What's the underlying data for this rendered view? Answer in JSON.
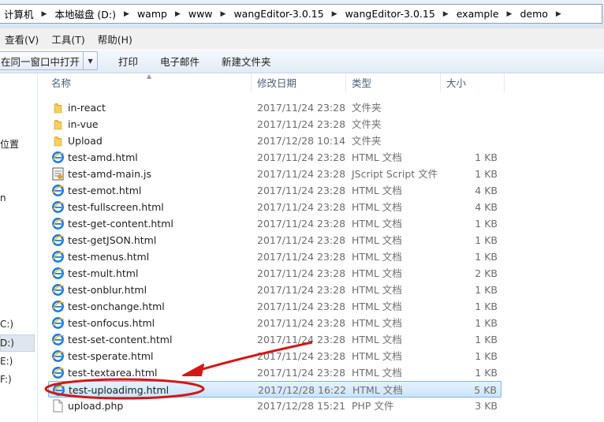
{
  "breadcrumb": [
    "计算机",
    "本地磁盘 (D:)",
    "wamp",
    "www",
    "wangEditor-3.0.15",
    "wangEditor-3.0.15",
    "example",
    "demo"
  ],
  "menu": [
    "查看(V)",
    "工具(T)",
    "帮助(H)"
  ],
  "toolbar": {
    "open_label": "在同一窗口中打开",
    "buttons": [
      "打印",
      "电子邮件",
      "新建文件夹"
    ]
  },
  "nav_items": [
    "位置",
    "n",
    "C:)",
    "D:)",
    "E:)",
    "F:)"
  ],
  "columns": {
    "name": "名称",
    "date": "修改日期",
    "type": "类型",
    "size": "大小"
  },
  "files": [
    {
      "name": "in-react",
      "date": "2017/11/24 23:28",
      "type": "文件夹",
      "size": "",
      "icon": "folder-icon"
    },
    {
      "name": "in-vue",
      "date": "2017/11/24 23:28",
      "type": "文件夹",
      "size": "",
      "icon": "folder-icon"
    },
    {
      "name": "Upload",
      "date": "2017/12/28 10:14",
      "type": "文件夹",
      "size": "",
      "icon": "folder-icon"
    },
    {
      "name": "test-amd.html",
      "date": "2017/11/24 23:28",
      "type": "HTML 文档",
      "size": "1 KB",
      "icon": "ie-html-icon"
    },
    {
      "name": "test-amd-main.js",
      "date": "2017/11/24 23:28",
      "type": "JScript Script 文件",
      "size": "1 KB",
      "icon": "jscript-icon"
    },
    {
      "name": "test-emot.html",
      "date": "2017/11/24 23:28",
      "type": "HTML 文档",
      "size": "4 KB",
      "icon": "ie-html-icon"
    },
    {
      "name": "test-fullscreen.html",
      "date": "2017/11/24 23:28",
      "type": "HTML 文档",
      "size": "4 KB",
      "icon": "ie-html-icon"
    },
    {
      "name": "test-get-content.html",
      "date": "2017/11/24 23:28",
      "type": "HTML 文档",
      "size": "1 KB",
      "icon": "ie-html-icon"
    },
    {
      "name": "test-getJSON.html",
      "date": "2017/11/24 23:28",
      "type": "HTML 文档",
      "size": "1 KB",
      "icon": "ie-html-icon"
    },
    {
      "name": "test-menus.html",
      "date": "2017/11/24 23:28",
      "type": "HTML 文档",
      "size": "1 KB",
      "icon": "ie-html-icon"
    },
    {
      "name": "test-mult.html",
      "date": "2017/11/24 23:28",
      "type": "HTML 文档",
      "size": "2 KB",
      "icon": "ie-html-icon"
    },
    {
      "name": "test-onblur.html",
      "date": "2017/11/24 23:28",
      "type": "HTML 文档",
      "size": "1 KB",
      "icon": "ie-html-icon"
    },
    {
      "name": "test-onchange.html",
      "date": "2017/11/24 23:28",
      "type": "HTML 文档",
      "size": "1 KB",
      "icon": "ie-html-icon"
    },
    {
      "name": "test-onfocus.html",
      "date": "2017/11/24 23:28",
      "type": "HTML 文档",
      "size": "1 KB",
      "icon": "ie-html-icon"
    },
    {
      "name": "test-set-content.html",
      "date": "2017/11/24 23:28",
      "type": "HTML 文档",
      "size": "1 KB",
      "icon": "ie-html-icon"
    },
    {
      "name": "test-sperate.html",
      "date": "2017/11/24 23:28",
      "type": "HTML 文档",
      "size": "1 KB",
      "icon": "ie-html-icon"
    },
    {
      "name": "test-textarea.html",
      "date": "2017/11/24 23:28",
      "type": "HTML 文档",
      "size": "1 KB",
      "icon": "ie-html-icon"
    },
    {
      "name": "test-uploadimg.html",
      "date": "2017/12/28 16:22",
      "type": "HTML 文档",
      "size": "5 KB",
      "icon": "ie-html-icon",
      "selected": true
    },
    {
      "name": "upload.php",
      "date": "2017/12/28 15:21",
      "type": "PHP 文件",
      "size": "3 KB",
      "icon": "php-file-icon"
    }
  ],
  "annotation": {
    "color": "#d11818"
  }
}
